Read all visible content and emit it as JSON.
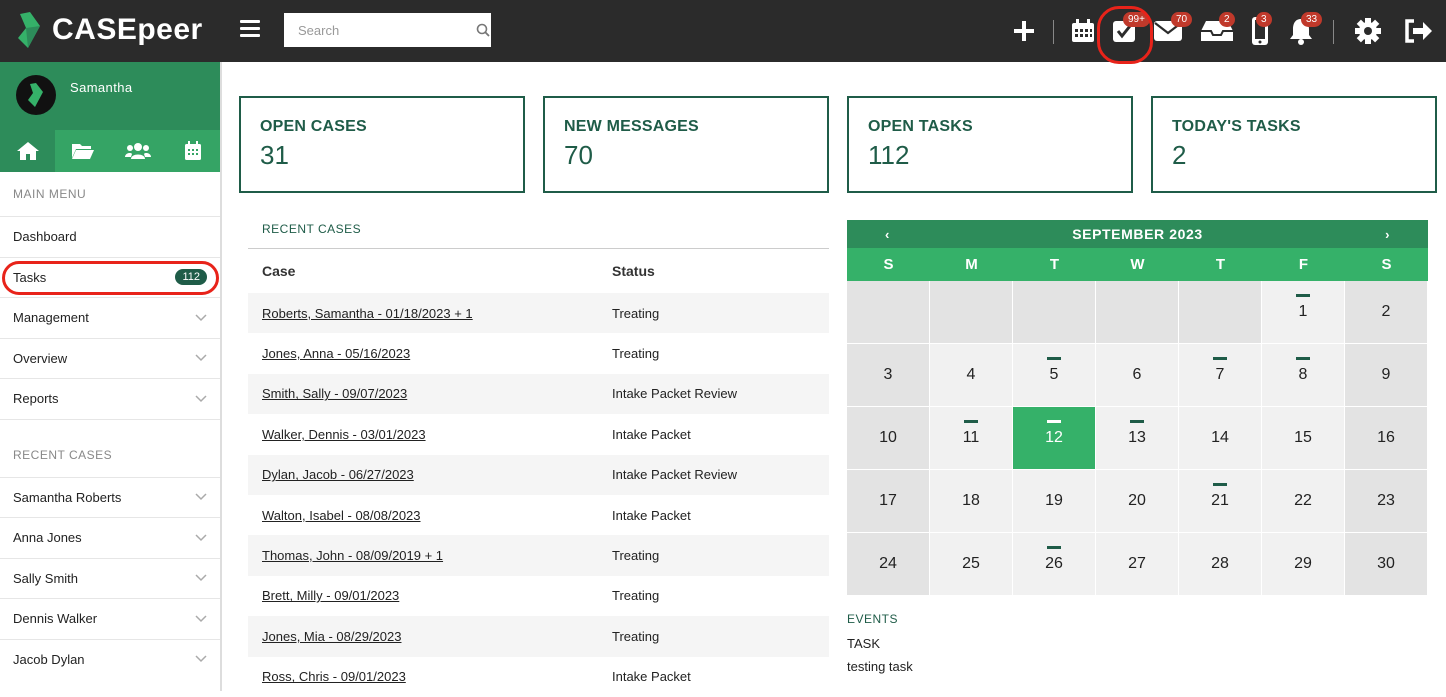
{
  "app": {
    "name": "CASEpeer",
    "search_placeholder": "Search"
  },
  "topbar": {
    "badges": {
      "tasks": "99+",
      "messages": "70",
      "inbox": "2",
      "phone": "3",
      "notifications": "33"
    }
  },
  "sidebar": {
    "user": "Samantha",
    "main_menu_label": "MAIN MENU",
    "menu": [
      {
        "label": "Dashboard"
      },
      {
        "label": "Tasks",
        "count": "112"
      },
      {
        "label": "Management"
      },
      {
        "label": "Overview"
      },
      {
        "label": "Reports"
      }
    ],
    "recent_label": "RECENT CASES",
    "recent": [
      {
        "label": "Samantha Roberts"
      },
      {
        "label": "Anna Jones"
      },
      {
        "label": "Sally Smith"
      },
      {
        "label": "Dennis Walker"
      },
      {
        "label": "Jacob Dylan"
      }
    ]
  },
  "cards": [
    {
      "title": "OPEN CASES",
      "value": "31"
    },
    {
      "title": "NEW MESSAGES",
      "value": "70"
    },
    {
      "title": "OPEN TASKS",
      "value": "112"
    },
    {
      "title": "TODAY'S TASKS",
      "value": "2"
    }
  ],
  "recent_cases": {
    "title": "RECENT CASES",
    "col_case": "Case",
    "col_status": "Status",
    "rows": [
      {
        "case": "Roberts, Samantha - 01/18/2023 + 1",
        "status": "Treating"
      },
      {
        "case": "Jones, Anna - 05/16/2023",
        "status": "Treating"
      },
      {
        "case": "Smith, Sally - 09/07/2023",
        "status": "Intake Packet Review"
      },
      {
        "case": "Walker, Dennis - 03/01/2023",
        "status": "Intake Packet"
      },
      {
        "case": "Dylan, Jacob - 06/27/2023",
        "status": "Intake Packet Review"
      },
      {
        "case": "Walton, Isabel - 08/08/2023",
        "status": "Intake Packet"
      },
      {
        "case": "Thomas, John - 08/09/2019 + 1",
        "status": "Treating"
      },
      {
        "case": "Brett, Milly - 09/01/2023",
        "status": "Treating"
      },
      {
        "case": "Jones, Mia - 08/29/2023",
        "status": "Treating"
      },
      {
        "case": "Ross, Chris - 09/01/2023",
        "status": "Intake Packet"
      }
    ]
  },
  "calendar": {
    "month_label": "SEPTEMBER 2023",
    "prev": "‹",
    "next": "›",
    "weekdays": [
      "S",
      "M",
      "T",
      "W",
      "T",
      "F",
      "S"
    ],
    "leading_blanks": 5,
    "days_in_month": 30,
    "today": 12,
    "marked_days": [
      1,
      5,
      7,
      8,
      11,
      12,
      13,
      21,
      26
    ]
  },
  "events": {
    "title": "EVENTS",
    "lines": [
      "TASK",
      "testing task"
    ]
  },
  "colors": {
    "brand_green": "#2d8c5a",
    "accent_green": "#35b169",
    "dark_green": "#1f5c48",
    "badge_red": "#c0392b",
    "highlight_red": "#e8231a"
  }
}
